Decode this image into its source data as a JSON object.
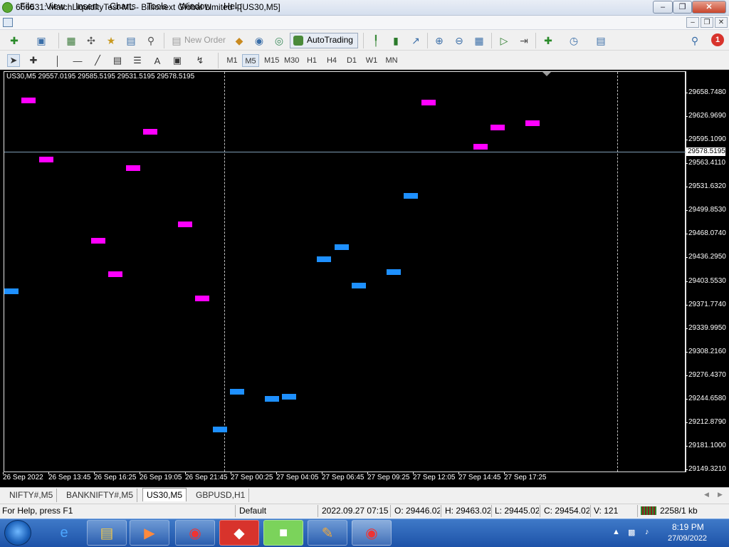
{
  "window": {
    "title": "666531: MatchLiquidityTest-ML - Billionext Global Limited - [US30,M5]"
  },
  "menu": {
    "file": "File",
    "view": "View",
    "insert": "Insert",
    "charts": "Charts",
    "tools": "Tools",
    "window": "Window",
    "help": "Help"
  },
  "toolbar": {
    "new_order": "New Order",
    "autotrading": "AutoTrading",
    "notification_count": "1"
  },
  "timeframes": [
    "M1",
    "M5",
    "M15",
    "M30",
    "H1",
    "H4",
    "D1",
    "W1",
    "MN"
  ],
  "active_timeframe": "M5",
  "chart": {
    "info": "US30,M5  29557.0195 29585.5195 29531.5195 29578.5195",
    "bid_label": "29578.5195",
    "bid_value": 29578.5195,
    "background": "#000000",
    "y_ticks": [
      "29658.7480",
      "29626.9690",
      "29595.1090",
      "29563.4110",
      "29531.6320",
      "29499.8530",
      "29468.0740",
      "29436.2950",
      "29403.5530",
      "29371.7740",
      "29339.9950",
      "29308.2160",
      "29276.4370",
      "29244.6580",
      "29212.8790",
      "29181.1000",
      "29149.3210"
    ],
    "x_ticks": [
      "26 Sep 2022",
      "26 Sep 13:45",
      "26 Sep 16:25",
      "26 Sep 19:05",
      "26 Sep 21:45",
      "27 Sep 00:25",
      "27 Sep 04:05",
      "27 Sep 06:45",
      "27 Sep 09:25",
      "27 Sep 12:05",
      "27 Sep 14:45",
      "27 Sep 17:25"
    ]
  },
  "chart_data": {
    "type": "scatter",
    "title": "US30,M5",
    "ylim": [
      29149.321,
      29658.748
    ],
    "x_ticks": [
      "26 Sep 2022",
      "26 Sep 13:45",
      "26 Sep 16:25",
      "26 Sep 19:05",
      "26 Sep 21:45",
      "27 Sep 00:25",
      "27 Sep 04:05",
      "27 Sep 06:45",
      "27 Sep 09:25",
      "27 Sep 12:05",
      "27 Sep 14:45",
      "27 Sep 17:25"
    ],
    "grid": false,
    "series": [
      {
        "color": "#ff00ff",
        "points": [
          [
            1,
            29648
          ],
          [
            2,
            29568
          ],
          [
            5,
            29458
          ],
          [
            6,
            29413
          ],
          [
            7,
            29557
          ],
          [
            8,
            29606
          ],
          [
            10,
            29481
          ],
          [
            11,
            29380
          ],
          [
            24,
            29645
          ],
          [
            27,
            29586
          ],
          [
            28,
            29612
          ],
          [
            30,
            29617
          ]
        ]
      },
      {
        "color": "#1e90ff",
        "points": [
          [
            0,
            29390
          ],
          [
            12,
            29203
          ],
          [
            13,
            29254
          ],
          [
            15,
            29245
          ],
          [
            16,
            29248
          ],
          [
            18,
            29433
          ],
          [
            19,
            29450
          ],
          [
            20,
            29398
          ],
          [
            22,
            29416
          ],
          [
            23,
            29519
          ]
        ]
      }
    ]
  },
  "tabs": [
    "NIFTY#,M5",
    "BANKNIFTY#,M5",
    "US30,M5",
    "GBPUSD,H1"
  ],
  "active_tab": "US30,M5",
  "status": {
    "help": "For Help, press F1",
    "profile": "Default",
    "datetime": "2022.09.27 07:15",
    "open": "O: 29446.02(",
    "high": "H: 29463.02(",
    "low": "L: 29445.02(",
    "close": "C: 29454.02(",
    "volume": "V: 121",
    "traffic": "2258/1 kb"
  },
  "taskbar": {
    "time": "8:19 PM",
    "date": "27/09/2022"
  }
}
